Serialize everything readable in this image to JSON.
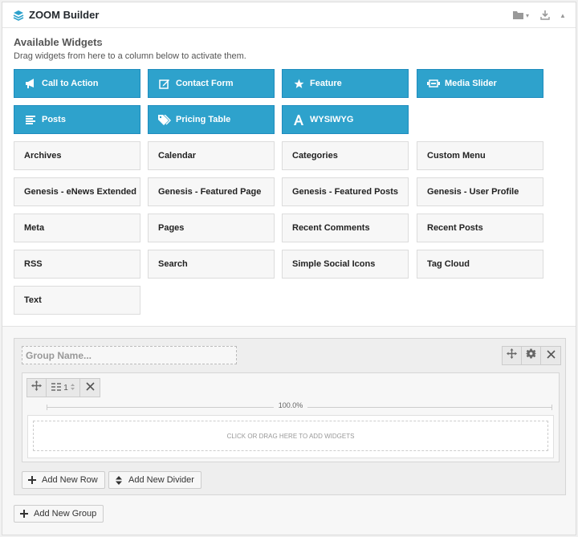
{
  "header": {
    "title": "ZOOM Builder",
    "icons": [
      "layers-icon",
      "folder-icon",
      "download-icon",
      "collapse-arrow-icon"
    ],
    "folder_caret": "▾",
    "collapse_glyph": "▲"
  },
  "widgets_section": {
    "title": "Available Widgets",
    "toggle_glyph": "▲",
    "description": "Drag widgets from here to a column below to activate them."
  },
  "featured_widgets": [
    {
      "label": "Call to Action",
      "icon": "megaphone-icon"
    },
    {
      "label": "Contact Form",
      "icon": "edit-form-icon"
    },
    {
      "label": "Feature",
      "icon": "star-icon"
    },
    {
      "label": "Media Slider",
      "icon": "slider-icon"
    },
    {
      "label": "Posts",
      "icon": "list-icon"
    },
    {
      "label": "Pricing Table",
      "icon": "tags-icon"
    },
    {
      "label": "WYSIWYG",
      "icon": "text-font-icon"
    }
  ],
  "standard_widgets": [
    "Archives",
    "Calendar",
    "Categories",
    "Custom Menu",
    "Genesis - eNews Extended",
    "Genesis - Featured Page",
    "Genesis - Featured Posts",
    "Genesis - User Profile",
    "Meta",
    "Pages",
    "Recent Comments",
    "Recent Posts",
    "RSS",
    "Search",
    "Simple Social Icons",
    "Tag Cloud",
    "Text"
  ],
  "group": {
    "name_placeholder": "Group Name...",
    "row": {
      "columns": "1",
      "width_percent": "100.0%",
      "dropzone_text": "CLICK OR DRAG HERE TO ADD WIDGETS"
    },
    "add_row_label": "Add New Row",
    "add_divider_label": "Add New Divider"
  },
  "add_group_label": "Add New Group",
  "colors": {
    "accent": "#2ea2cc",
    "accent_border": "#1e8cbe"
  }
}
